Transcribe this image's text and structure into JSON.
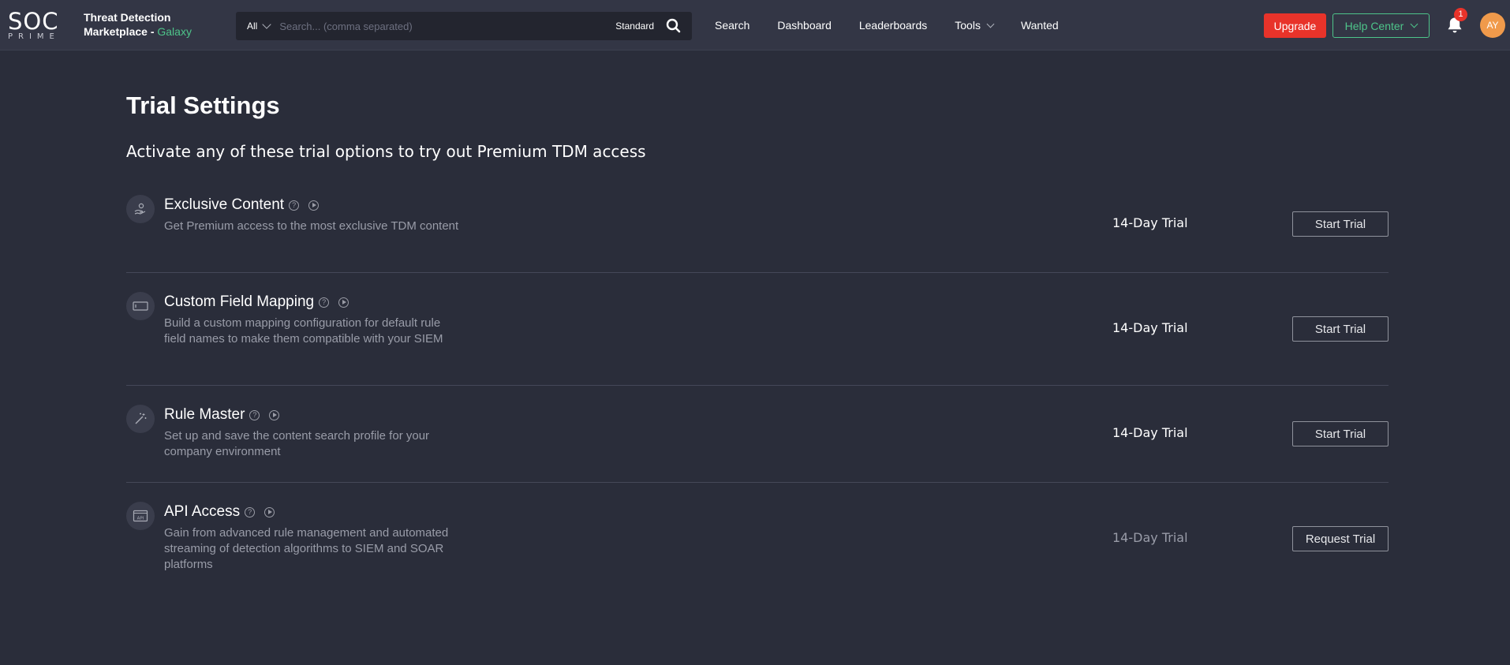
{
  "header": {
    "logo_main": "SOC",
    "logo_sub": "PRIME",
    "brand_line1": "Threat Detection",
    "brand_line2": "Marketplace -",
    "brand_galaxy": "Galaxy",
    "search_scope": "All",
    "search_placeholder": "Search... (comma separated)",
    "search_mode": "Standard",
    "nav": [
      "Search",
      "Dashboard",
      "Leaderboards",
      "Tools",
      "Wanted"
    ],
    "upgrade_label": "Upgrade",
    "help_label": "Help Center",
    "notification_count": "1",
    "avatar_initials": "AY",
    "colors": {
      "upgrade": "#e8332a",
      "accent_green": "#4ec48a",
      "avatar": "#f09a4b"
    }
  },
  "main": {
    "title": "Trial Settings",
    "subtitle": "Activate any of these trial options to try out Premium TDM access",
    "trials": [
      {
        "icon": "hand-coin-icon",
        "title": "Exclusive Content",
        "description": "Get Premium access to the most exclusive TDM content",
        "trial_label": "14-Day Trial",
        "button_label": "Start Trial"
      },
      {
        "icon": "field-mapping-icon",
        "title": "Custom Field Mapping",
        "description": "Build a custom mapping configuration for default rule field names to make them compatible with your SIEM",
        "trial_label": "14-Day Trial",
        "button_label": "Start Trial"
      },
      {
        "icon": "magic-wand-icon",
        "title": "Rule Master",
        "description": "Set up and save the content search profile for your company environment",
        "trial_label": "14-Day Trial",
        "button_label": "Start Trial"
      },
      {
        "icon": "api-icon",
        "title": "API Access",
        "description": "Gain from advanced rule management and automated streaming of detection algorithms to SIEM and SOAR platforms",
        "trial_label": "14-Day Trial",
        "button_label": "Request Trial"
      }
    ]
  }
}
